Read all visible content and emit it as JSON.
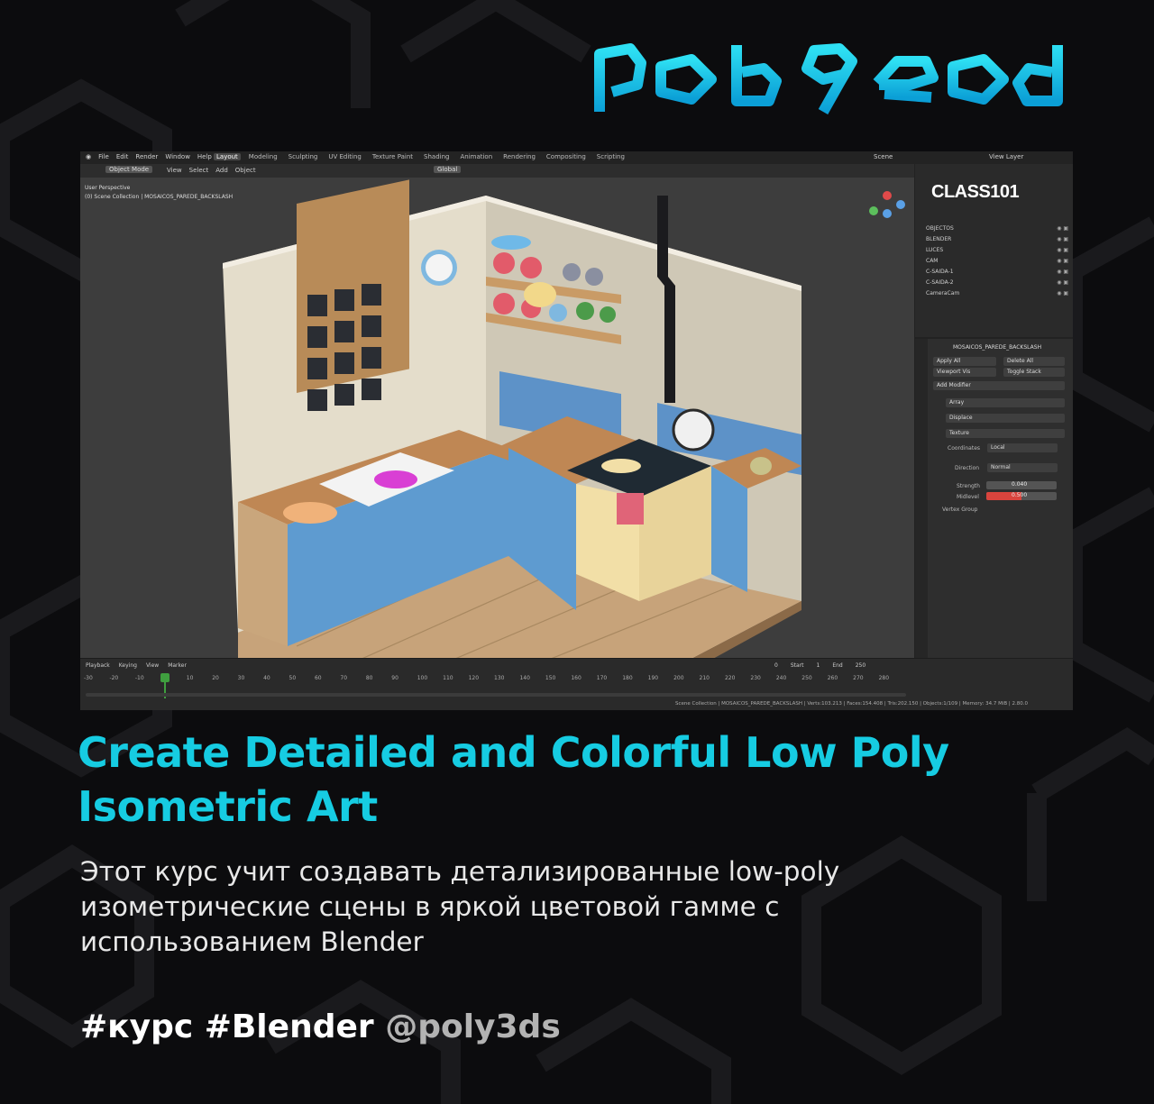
{
  "brand": {
    "logo_text": "polyeadd",
    "logo_color": "#17c8e6"
  },
  "screenshot": {
    "menu": [
      "File",
      "Edit",
      "Render",
      "Window",
      "Help"
    ],
    "workspace_tabs": [
      "Layout",
      "Modeling",
      "Sculpting",
      "UV Editing",
      "Texture Paint",
      "Shading",
      "Animation",
      "Rendering",
      "Compositing",
      "Scripting"
    ],
    "active_tab": "Layout",
    "scene_label": "Scene",
    "view_layer_label": "View Layer",
    "mode": "Object Mode",
    "view_menu": [
      "View",
      "Select",
      "Add",
      "Object"
    ],
    "orientation": "Global",
    "viewport_info_line1": "User Perspective",
    "viewport_info_line2": "(0) Scene Collection | MOSAICOS_PAREDE_BACKSLASH",
    "watermark": "CLASS101",
    "outliner_rows": [
      {
        "label": "OBJECTOS"
      },
      {
        "label": "BLENDER"
      },
      {
        "label": "LUCES"
      },
      {
        "label": "CAM"
      },
      {
        "label": "C-SAIDA-1"
      },
      {
        "label": "C-SAIDA-2"
      },
      {
        "label": "CameraCam"
      }
    ],
    "properties": {
      "object_name": "MOSAICOS_PAREDE_BACKSLASH",
      "apply_all": "Apply All",
      "delete_all": "Delete All",
      "viewport_vis": "Viewport Vis",
      "toggle_stack": "Toggle Stack",
      "add_modifier": "Add Modifier",
      "modifier_1": "Array",
      "modifier_2": "Displace",
      "texture_label": "Texture",
      "coordinates_label": "Coordinates",
      "coordinates_value": "Local",
      "direction_label": "Direction",
      "direction_value": "Normal",
      "strength_label": "Strength",
      "strength_value": "0.040",
      "midlevel_label": "Midlevel",
      "midlevel_value": "0.500",
      "vertex_group_label": "Vertex Group"
    },
    "timeline": {
      "menu": [
        "Playback",
        "Keying",
        "View",
        "Marker"
      ],
      "current_frame": "0",
      "start_label": "Start",
      "start_value": "1",
      "end_label": "End",
      "end_value": "250",
      "ruler": [
        "-30",
        "-20",
        "-10",
        "0",
        "10",
        "20",
        "30",
        "40",
        "50",
        "60",
        "70",
        "80",
        "90",
        "100",
        "110",
        "120",
        "130",
        "140",
        "150",
        "160",
        "170",
        "180",
        "190",
        "200",
        "210",
        "220",
        "230",
        "240",
        "250",
        "260",
        "270",
        "280"
      ]
    },
    "status_bar": "Scene Collection | MOSAICOS_PAREDE_BACKSLASH | Verts:103.213 | Faces:154.408 | Tris:202.150 | Objects:1/109 | Memory: 34.7 MiB | 2.80.0"
  },
  "title": "Create Detailed and Colorful Low Poly Isometric Art",
  "description": "Этот курс учит создавать детализированные low-poly изометрические сцены в яркой цветовой гамме с использованием Blender",
  "tags": "#курс #Blender",
  "handle": "@poly3ds",
  "colors": {
    "accent": "#16cce2",
    "background": "#0c0c0e",
    "handle": "#b3b3b3"
  }
}
